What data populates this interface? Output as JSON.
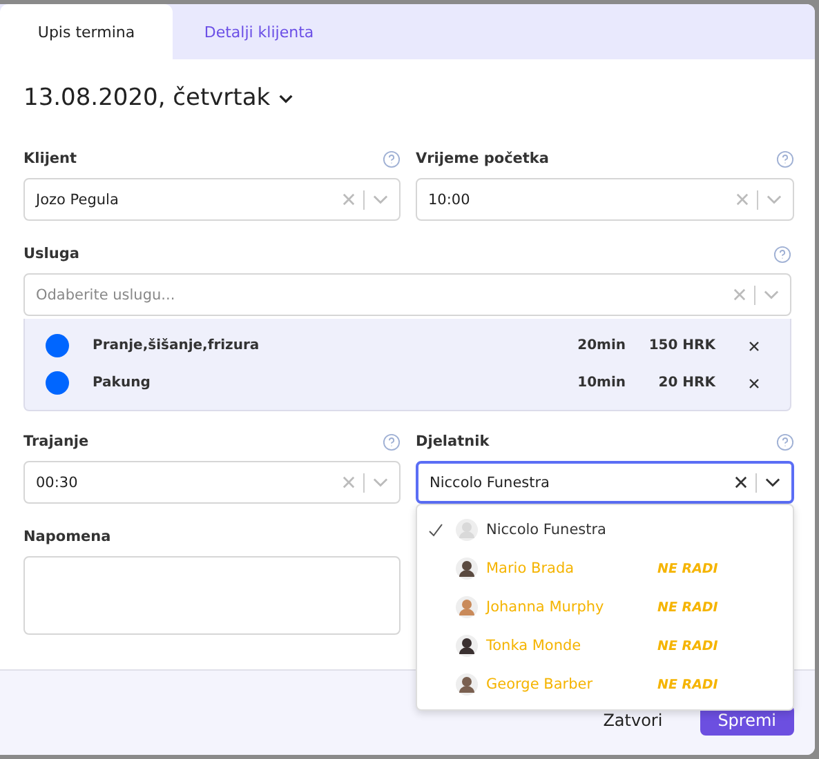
{
  "tabs": [
    {
      "label": "Upis termina",
      "selected": true
    },
    {
      "label": "Detalji klijenta",
      "selected": false
    }
  ],
  "date": "13.08.2020, četvrtak",
  "fields": {
    "client": {
      "label": "Klijent",
      "value": "Jozo Pegula"
    },
    "start": {
      "label": "Vrijeme početka",
      "value": "10:00"
    },
    "service": {
      "label": "Usluga",
      "placeholder": "Odaberite uslugu..."
    },
    "duration": {
      "label": "Trajanje",
      "value": "00:30"
    },
    "staff": {
      "label": "Djelatnik",
      "value": "Niccolo Funestra",
      "focused": true
    },
    "note": {
      "label": "Napomena"
    }
  },
  "services": [
    {
      "name": "Pranje,šišanje,frizura",
      "duration": "20min",
      "price": "150 HRK",
      "color": "#0066ff"
    },
    {
      "name": "Pakung",
      "duration": "10min",
      "price": "20 HRK",
      "color": "#0066ff"
    }
  ],
  "staff_options": [
    {
      "name": "Niccolo Funestra",
      "selected": true,
      "available": true
    },
    {
      "name": "Mario Brada",
      "selected": false,
      "available": false,
      "status": "NE RADI"
    },
    {
      "name": "Johanna Murphy",
      "selected": false,
      "available": false,
      "status": "NE RADI"
    },
    {
      "name": "Tonka Monde",
      "selected": false,
      "available": false,
      "status": "NE RADI"
    },
    {
      "name": "George Barber",
      "selected": false,
      "available": false,
      "status": "NE RADI"
    }
  ],
  "buttons": [
    {
      "label": "Zatvori",
      "kind": "text"
    },
    {
      "label": "Spremi",
      "kind": "primary"
    }
  ]
}
